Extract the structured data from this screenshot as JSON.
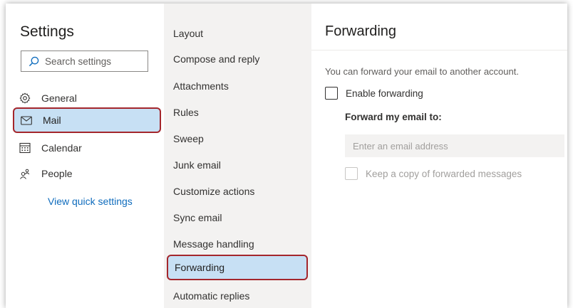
{
  "left_pane": {
    "title": "Settings",
    "search": {
      "placeholder": "Search settings",
      "value": ""
    },
    "nav": [
      {
        "label": "General",
        "icon": "gear-icon",
        "selected": false
      },
      {
        "label": "Mail",
        "icon": "mail-icon",
        "selected": true
      },
      {
        "label": "Calendar",
        "icon": "calendar-icon",
        "selected": false
      },
      {
        "label": "People",
        "icon": "people-icon",
        "selected": false
      }
    ],
    "quick_settings_link": "View quick settings"
  },
  "middle_pane": {
    "items": [
      {
        "label": "Layout",
        "selected": false
      },
      {
        "label": "Compose and reply",
        "selected": false
      },
      {
        "label": "Attachments",
        "selected": false
      },
      {
        "label": "Rules",
        "selected": false
      },
      {
        "label": "Sweep",
        "selected": false
      },
      {
        "label": "Junk email",
        "selected": false
      },
      {
        "label": "Customize actions",
        "selected": false
      },
      {
        "label": "Sync email",
        "selected": false
      },
      {
        "label": "Message handling",
        "selected": false
      },
      {
        "label": "Forwarding",
        "selected": true
      },
      {
        "label": "Automatic replies",
        "selected": false
      }
    ]
  },
  "right_pane": {
    "title": "Forwarding",
    "description": "You can forward your email to another account.",
    "enable_forwarding": {
      "label": "Enable forwarding",
      "checked": false
    },
    "forward_to_label": "Forward my email to:",
    "email_input": {
      "placeholder": "Enter an email address",
      "value": "",
      "disabled": true
    },
    "keep_copy": {
      "label": "Keep a copy of forwarded messages",
      "checked": false,
      "disabled": true
    }
  },
  "colors": {
    "selected_bg": "#c7e0f4",
    "highlight_border": "#a4262c",
    "link": "#0f6cbd",
    "middle_bg": "#f3f2f1"
  }
}
